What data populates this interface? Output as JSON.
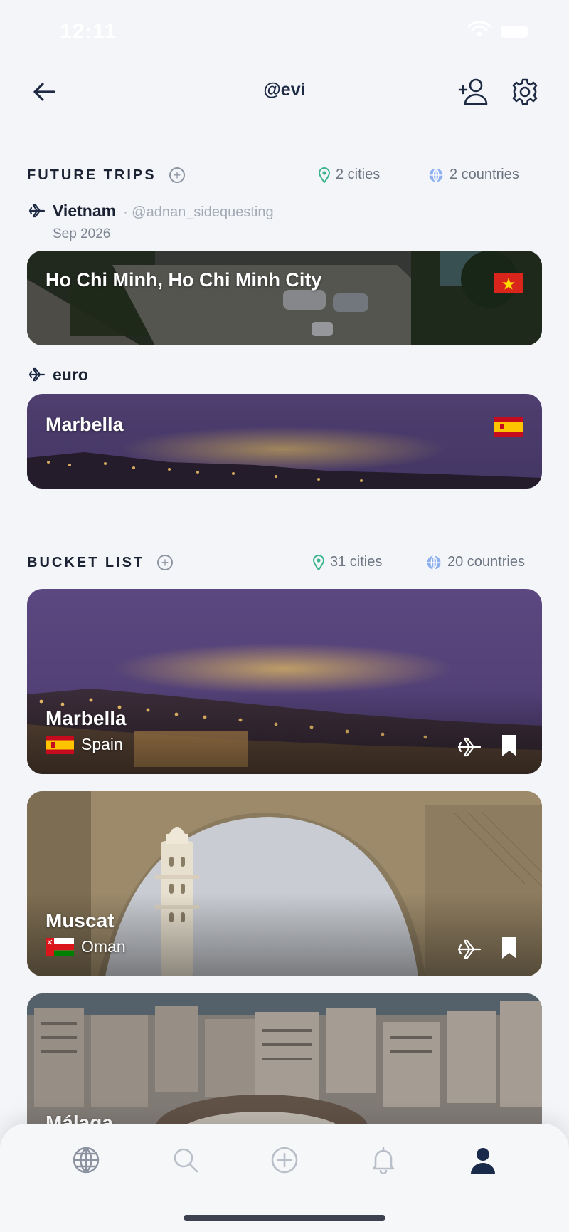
{
  "status": {
    "time": "12:11"
  },
  "header": {
    "title": "@evi"
  },
  "future_trips": {
    "title": "FUTURE TRIPS",
    "cities": "2 cities",
    "countries": "2 countries",
    "trips": [
      {
        "name": "Vietnam",
        "user": "· @adnan_sidequesting",
        "date": "Sep 2026",
        "card": {
          "title": "Ho Chi Minh, Ho Chi Minh City",
          "flag": "vietnam-flag"
        }
      },
      {
        "name": "euro",
        "card": {
          "title": "Marbella",
          "flag": "spain-flag"
        }
      }
    ]
  },
  "bucket_list": {
    "title": "BUCKET LIST",
    "cities": "31 cities",
    "countries": "20 countries",
    "cards": [
      {
        "city": "Marbella",
        "country": "Spain",
        "flag": "spain-flag"
      },
      {
        "city": "Muscat",
        "country": "Oman",
        "flag": "oman-flag"
      },
      {
        "city": "Málaga"
      }
    ]
  },
  "tabs": [
    "globe-icon",
    "search-icon",
    "add-icon",
    "bell-icon",
    "profile-icon"
  ],
  "colors": {
    "accent": "#1e2a44",
    "pin": "#3bb58a",
    "globe": "#6b8fd6"
  }
}
